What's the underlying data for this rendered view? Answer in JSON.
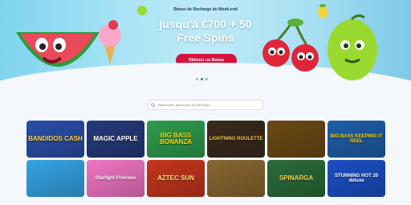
{
  "hero": {
    "subtitle": "Bonus de Recharge du Week-end",
    "title_line1": "jusqu'à €700 + 50",
    "title_line2": "Free Spins",
    "cta_label": "Obtenez un Bonus",
    "slide_count": 3,
    "active_slide": 2
  },
  "search": {
    "placeholder": "Rechercher parmi plus de 3000 jeux"
  },
  "games": [
    {
      "name": "game-bandidos-cash",
      "title": "BANDIDOS CASH",
      "bg": "#2a4fa8",
      "fg": "#ffd23b"
    },
    {
      "name": "game-magic-apple",
      "title": "MAGIC APPLE",
      "bg": "#253a7a",
      "fg": "#ffffff"
    },
    {
      "name": "game-big-bass-bonanza",
      "title": "BIG BASS BONANZA",
      "bg": "#2f9c4d",
      "fg": "#ffd400"
    },
    {
      "name": "game-lightning-roulette",
      "title": "LIGHTNING ROULETTE",
      "bg": "#3a2a1c",
      "fg": "#f4c64a"
    },
    {
      "name": "game-book-slot",
      "title": "",
      "bg": "#6b4a14",
      "fg": "#ffd36a"
    },
    {
      "name": "game-big-bass-keeping-it-reel",
      "title": "BIG BASS KEEPING IT REEL",
      "bg": "#1f5fa8",
      "fg": "#ffd400"
    },
    {
      "name": "game-shark-slot",
      "title": "",
      "bg": "#35a4e6",
      "fg": "#ffffff"
    },
    {
      "name": "game-starlight-princess",
      "title": "Starlight Princess",
      "bg": "#f075c4",
      "fg": "#ffffff"
    },
    {
      "name": "game-aztec-sun",
      "title": "AZTEC SUN",
      "bg": "#c4361c",
      "fg": "#ffe27a"
    },
    {
      "name": "game-book-of-dead",
      "title": "",
      "bg": "#8a6630",
      "fg": "#f2d38a"
    },
    {
      "name": "game-spinarga",
      "title": "SPINARGA",
      "bg": "#2b6b3a",
      "fg": "#f6d24a"
    },
    {
      "name": "game-stunning-hot-20-deluxe",
      "title": "STUNNING HOT 20 deluxe",
      "bg": "#1c4fc4",
      "fg": "#ffffff"
    }
  ]
}
